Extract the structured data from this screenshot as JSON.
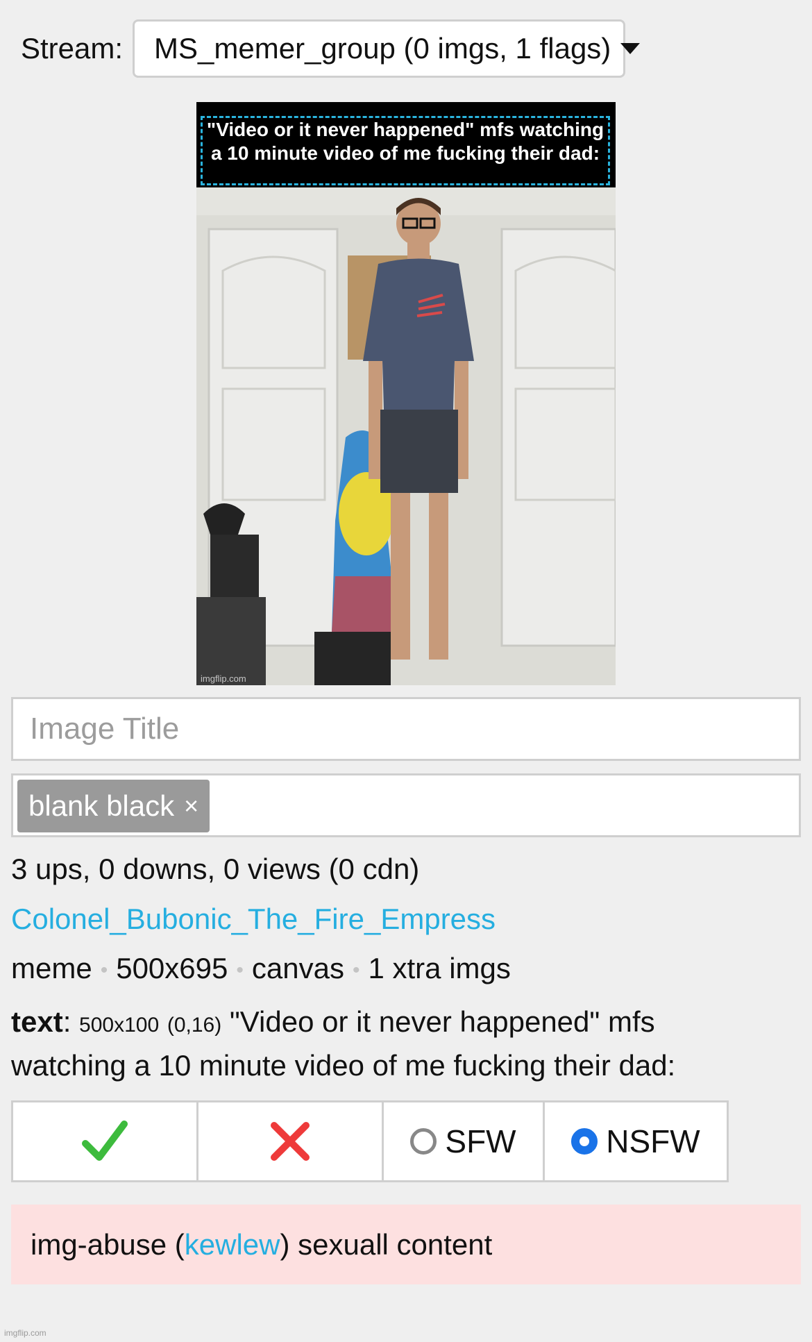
{
  "stream": {
    "label": "Stream:",
    "selected": "MS_memer_group (0 imgs, 1 flags)"
  },
  "meme": {
    "caption": "\"Video or it never happened\" mfs watching a 10 minute video of me fucking their dad:",
    "watermark": "imgflip.com"
  },
  "title_input": {
    "placeholder": "Image Title",
    "value": ""
  },
  "tags": [
    {
      "label": "blank black",
      "remove": "×"
    }
  ],
  "stats": "3 ups, 0 downs, 0 views (0 cdn)",
  "author": "Colonel_Bubonic_The_Fire_Empress",
  "meta": [
    "meme",
    "500x695",
    "canvas",
    "1 xtra imgs"
  ],
  "text_info": {
    "label": "text",
    "dims": "500x100",
    "pos": "(0,16)",
    "content": "\"Video or it never happened\" mfs watching a 10 minute video of me fucking their dad:"
  },
  "moderation": {
    "approve_icon": "check-icon",
    "reject_icon": "cross-icon",
    "sfw_label": "SFW",
    "nsfw_label": "NSFW",
    "selected": "NSFW"
  },
  "flag": {
    "prefix": "img-abuse (",
    "user": "kewlew",
    "suffix": ") sexuall content"
  },
  "footer_watermark": "imgflip.com",
  "colors": {
    "link": "#25aee0",
    "approve": "#3dbb3d",
    "reject": "#ee3a3a",
    "radio_on": "#1a73e8",
    "flag_bg": "#fde0e0"
  }
}
